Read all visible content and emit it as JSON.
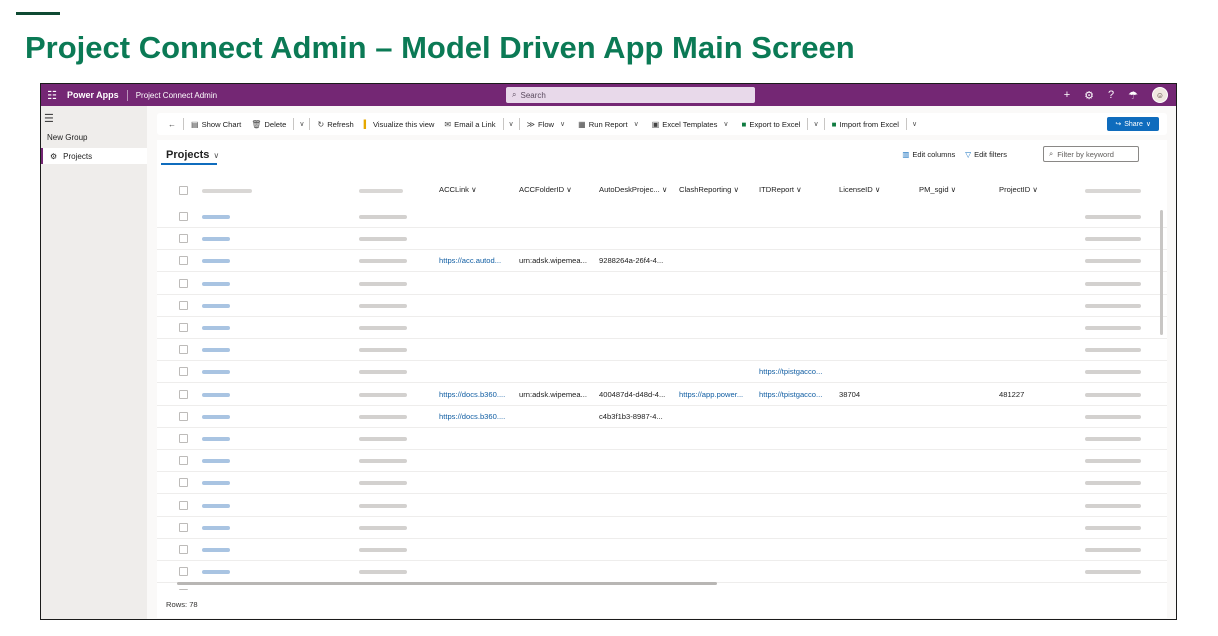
{
  "slide": {
    "title": "Project Connect Admin – Model Driven App Main Screen"
  },
  "topbar": {
    "brand": "Power Apps",
    "app_name": "Project Connect Admin",
    "search_placeholder": "Search",
    "background_color": "#742774"
  },
  "sidebar": {
    "group_label": "New Group",
    "items": [
      {
        "label": "Projects",
        "icon": "gear-icon"
      }
    ]
  },
  "commands": {
    "show_chart": "Show Chart",
    "delete": "Delete",
    "refresh": "Refresh",
    "visualize": "Visualize this view",
    "email_link": "Email a Link",
    "flow": "Flow",
    "run_report": "Run Report",
    "excel_templates": "Excel Templates",
    "export_excel": "Export to Excel",
    "import_excel": "Import from Excel",
    "share": "Share"
  },
  "view": {
    "title": "Projects",
    "edit_columns": "Edit columns",
    "edit_filters": "Edit filters",
    "filter_placeholder": "Filter by keyword"
  },
  "grid": {
    "columns": [
      "ACCLink",
      "ACCFolderID",
      "AutoDeskProjec...",
      "ClashReporting",
      "ITDReport",
      "LicenseID",
      "PM_sgid",
      "ProjectID"
    ],
    "rows": [
      {
        "acc_link": "",
        "folder": "",
        "autodesk": "",
        "clash": "",
        "itd": "",
        "license": "",
        "pm": "",
        "project": ""
      },
      {
        "acc_link": "",
        "folder": "",
        "autodesk": "",
        "clash": "",
        "itd": "",
        "license": "",
        "pm": "",
        "project": ""
      },
      {
        "acc_link": "https://acc.autod...",
        "folder": "urn:adsk.wipemea...",
        "autodesk": "9288264a-26f4-4...",
        "clash": "",
        "itd": "",
        "license": "",
        "pm": "",
        "project": ""
      },
      {
        "acc_link": "",
        "folder": "",
        "autodesk": "",
        "clash": "",
        "itd": "",
        "license": "",
        "pm": "",
        "project": ""
      },
      {
        "acc_link": "",
        "folder": "",
        "autodesk": "",
        "clash": "",
        "itd": "",
        "license": "",
        "pm": "",
        "project": ""
      },
      {
        "acc_link": "",
        "folder": "",
        "autodesk": "",
        "clash": "",
        "itd": "",
        "license": "",
        "pm": "",
        "project": ""
      },
      {
        "acc_link": "",
        "folder": "",
        "autodesk": "",
        "clash": "",
        "itd": "",
        "license": "",
        "pm": "",
        "project": ""
      },
      {
        "acc_link": "",
        "folder": "",
        "autodesk": "",
        "clash": "",
        "itd": "https://tpistgacco...",
        "license": "",
        "pm": "",
        "project": ""
      },
      {
        "acc_link": "https://docs.b360....",
        "folder": "urn:adsk.wipemea...",
        "autodesk": "400487d4-d48d-4...",
        "clash": "https://app.power...",
        "itd": "https://tpistgacco...",
        "license": "38704",
        "pm": "",
        "project": "481227"
      },
      {
        "acc_link": "https://docs.b360....",
        "folder": "",
        "autodesk": "c4b3f1b3-8987-4...",
        "clash": "",
        "itd": "",
        "license": "",
        "pm": "",
        "project": ""
      },
      {
        "acc_link": "",
        "folder": "",
        "autodesk": "",
        "clash": "",
        "itd": "",
        "license": "",
        "pm": "",
        "project": ""
      },
      {
        "acc_link": "",
        "folder": "",
        "autodesk": "",
        "clash": "",
        "itd": "",
        "license": "",
        "pm": "",
        "project": ""
      },
      {
        "acc_link": "",
        "folder": "",
        "autodesk": "",
        "clash": "",
        "itd": "",
        "license": "",
        "pm": "",
        "project": ""
      },
      {
        "acc_link": "",
        "folder": "",
        "autodesk": "",
        "clash": "",
        "itd": "",
        "license": "",
        "pm": "",
        "project": ""
      },
      {
        "acc_link": "",
        "folder": "",
        "autodesk": "",
        "clash": "",
        "itd": "",
        "license": "",
        "pm": "",
        "project": ""
      },
      {
        "acc_link": "",
        "folder": "",
        "autodesk": "",
        "clash": "",
        "itd": "",
        "license": "",
        "pm": "",
        "project": ""
      },
      {
        "acc_link": "",
        "folder": "",
        "autodesk": "",
        "clash": "",
        "itd": "",
        "license": "",
        "pm": "",
        "project": ""
      },
      {
        "acc_link": "",
        "folder": "",
        "autodesk": "",
        "clash": "",
        "itd": "",
        "license": "",
        "pm": "",
        "project": ""
      }
    ],
    "footer": "Rows: 78"
  }
}
